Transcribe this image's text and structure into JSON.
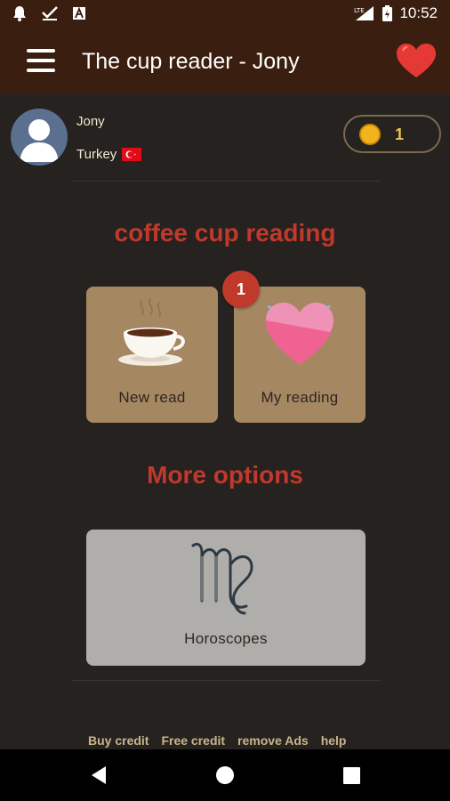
{
  "status_bar": {
    "time": "10:52",
    "icons": [
      "notification-bell-icon",
      "checkmark-icon",
      "font-a-icon",
      "lte-signal-icon",
      "battery-icon"
    ]
  },
  "app_bar": {
    "title": "The cup reader - Jony",
    "menu_icon": "hamburger-menu-icon",
    "favorite_icon": "heart-icon"
  },
  "profile": {
    "name": "Jony",
    "country": "Turkey",
    "flag_icon": "turkey-flag-icon",
    "credits": "1"
  },
  "coffee_section": {
    "title": "coffee cup reading",
    "tiles": [
      {
        "label": "New read",
        "icon": "coffee-cup-icon"
      },
      {
        "label": "My reading",
        "icon": "heart-icon",
        "badge": "1"
      }
    ]
  },
  "more_section": {
    "title": "More options",
    "tiles": [
      {
        "label": "Horoscopes",
        "icon": "virgo-zodiac-icon"
      }
    ]
  },
  "footer_links": [
    "Buy credit",
    "Free credit",
    "remove Ads",
    "help"
  ],
  "colors": {
    "app_bar": "#3a1e0f",
    "background": "#252220",
    "accent_red": "#c0392b",
    "tile_tan": "#a58762",
    "tile_gray": "#b0aeab",
    "coin_gold": "#f2b31c"
  }
}
